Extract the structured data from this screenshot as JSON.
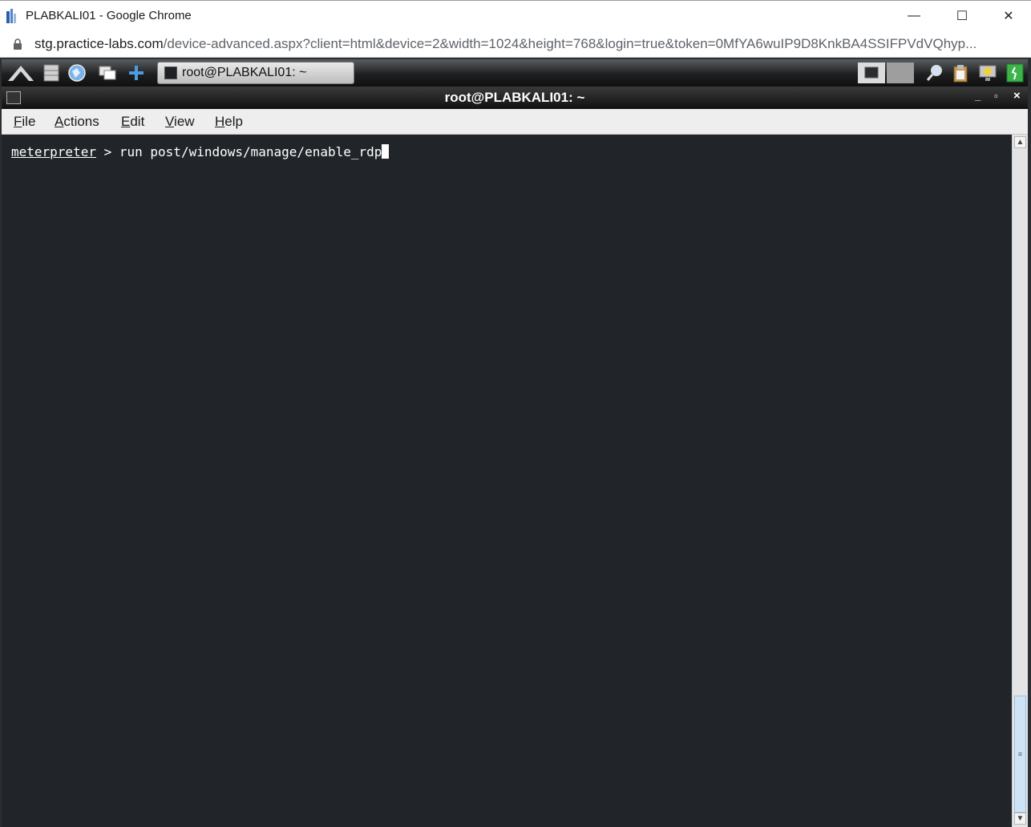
{
  "chrome": {
    "title": "PLABKALI01 - Google Chrome",
    "minimize": "—",
    "maximize": "☐",
    "close": "✕"
  },
  "address": {
    "host": "stg.practice-labs.com",
    "path": "/device-advanced.aspx?client=html&device=2&width=1024&height=768&login=true&token=0MfYA6wuIP9D8KnkBA4SSIFPVdVQhyp..."
  },
  "taskbar": {
    "task_label": "root@PLABKALI01: ~"
  },
  "terminal_window": {
    "title": "root@PLABKALI01: ~",
    "minimize": "_",
    "maximize": "▫",
    "close": "×"
  },
  "menu": {
    "items": [
      {
        "mnemonic": "F",
        "rest": "ile"
      },
      {
        "mnemonic": "A",
        "rest": "ctions"
      },
      {
        "mnemonic": "E",
        "rest": "dit"
      },
      {
        "mnemonic": "V",
        "rest": "iew"
      },
      {
        "mnemonic": "H",
        "rest": "elp"
      }
    ]
  },
  "terminal": {
    "prompt": "meterpreter",
    "separator": " > ",
    "command": "run post/windows/manage/enable_rdp"
  },
  "colors": {
    "terminal_bg": "#212529",
    "terminal_fg": "#ffffff",
    "menubar_bg": "#eeeeee"
  }
}
